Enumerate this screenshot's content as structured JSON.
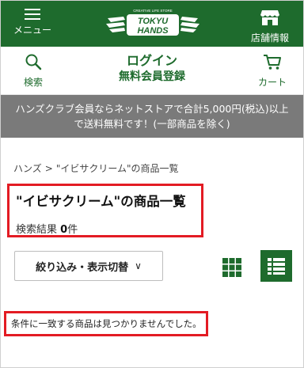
{
  "header": {
    "menu_label": "メニュー",
    "logo_tagline": "CREATIVE LIFE STORE",
    "logo_line1": "TOKYU",
    "logo_line2": "HANDS",
    "store_label": "店舗情報"
  },
  "subheader": {
    "search_label": "検索",
    "login_label": "ログイン",
    "register_label": "無料会員登録",
    "cart_label": "カート"
  },
  "notice": {
    "line1": "ハンズクラブ会員ならネットストアで合計5,000円(税込)以上",
    "line2": "で送料無料です！(一部商品を除く)"
  },
  "breadcrumb": {
    "home": "ハンズ",
    "separator": ">",
    "current": "\"イビサクリーム\"の商品一覧"
  },
  "results": {
    "title": "\"イビサクリーム\"の商品一覧",
    "count_prefix": "検索結果",
    "count_value": "0",
    "count_suffix": "件"
  },
  "toolbar": {
    "filter_label": "絞り込み・表示切替",
    "filter_chevron": "∨"
  },
  "empty_message": "条件に一致する商品は見つかりませんでした。",
  "colors": {
    "brand_green": "#1e6b2d",
    "highlight_red": "#e31b23",
    "notice_gray": "#7a7a7a"
  },
  "icons": {
    "menu": "hamburger-icon",
    "store": "store-icon",
    "search": "search-icon",
    "cart": "cart-icon",
    "grid_view": "grid-view-icon",
    "list_view": "list-view-icon"
  }
}
